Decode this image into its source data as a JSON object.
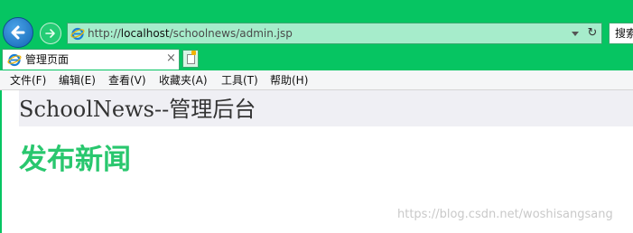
{
  "browser": {
    "address": {
      "prefix": "http://",
      "host": "localhost",
      "path": "/schoolnews/admin.jsp"
    },
    "search_label": "搜索",
    "tab": {
      "title": "管理页面",
      "close": "×"
    },
    "refresh_glyph": "↻"
  },
  "menubar": {
    "items": [
      {
        "label": "文件(F)"
      },
      {
        "label": "编辑(E)"
      },
      {
        "label": "查看(V)"
      },
      {
        "label": "收藏夹(A)"
      },
      {
        "label": "工具(T)"
      },
      {
        "label": "帮助(H)"
      }
    ]
  },
  "page": {
    "header_title": "SchoolNews--管理后台",
    "section_heading": "发布新闻",
    "watermark": "https://blog.csdn.net/woshisangsang"
  },
  "colors": {
    "chrome": "#06c562",
    "address_bg": "#a6eccb",
    "heading": "#29c76e"
  },
  "icons": [
    "back-arrow-icon",
    "forward-arrow-icon",
    "ie-icon",
    "dropdown-icon",
    "refresh-icon",
    "close-icon",
    "new-tab-icon"
  ]
}
